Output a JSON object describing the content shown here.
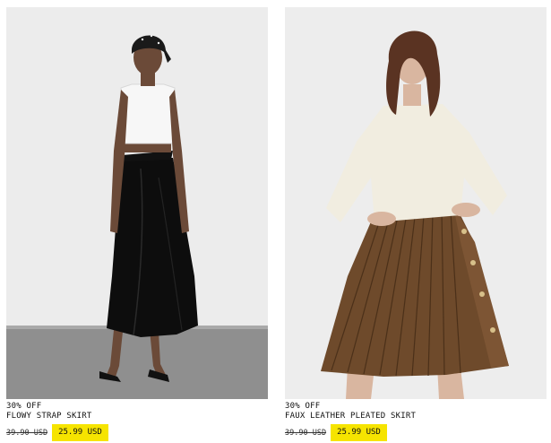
{
  "products": [
    {
      "discount": "30% OFF",
      "name": "FLOWY STRAP SKIRT",
      "old_price": "39.90 USD",
      "new_price": "25.99 USD",
      "image_icon": "model-black-skirt-image"
    },
    {
      "discount": "30% OFF",
      "name": "FAUX LEATHER PLEATED SKIRT",
      "old_price": "39.90 USD",
      "new_price": "25.99 USD",
      "image_icon": "model-brown-pleated-skirt-image"
    }
  ],
  "colors": {
    "price_highlight": "#f6e400",
    "background": "#ffffff"
  }
}
